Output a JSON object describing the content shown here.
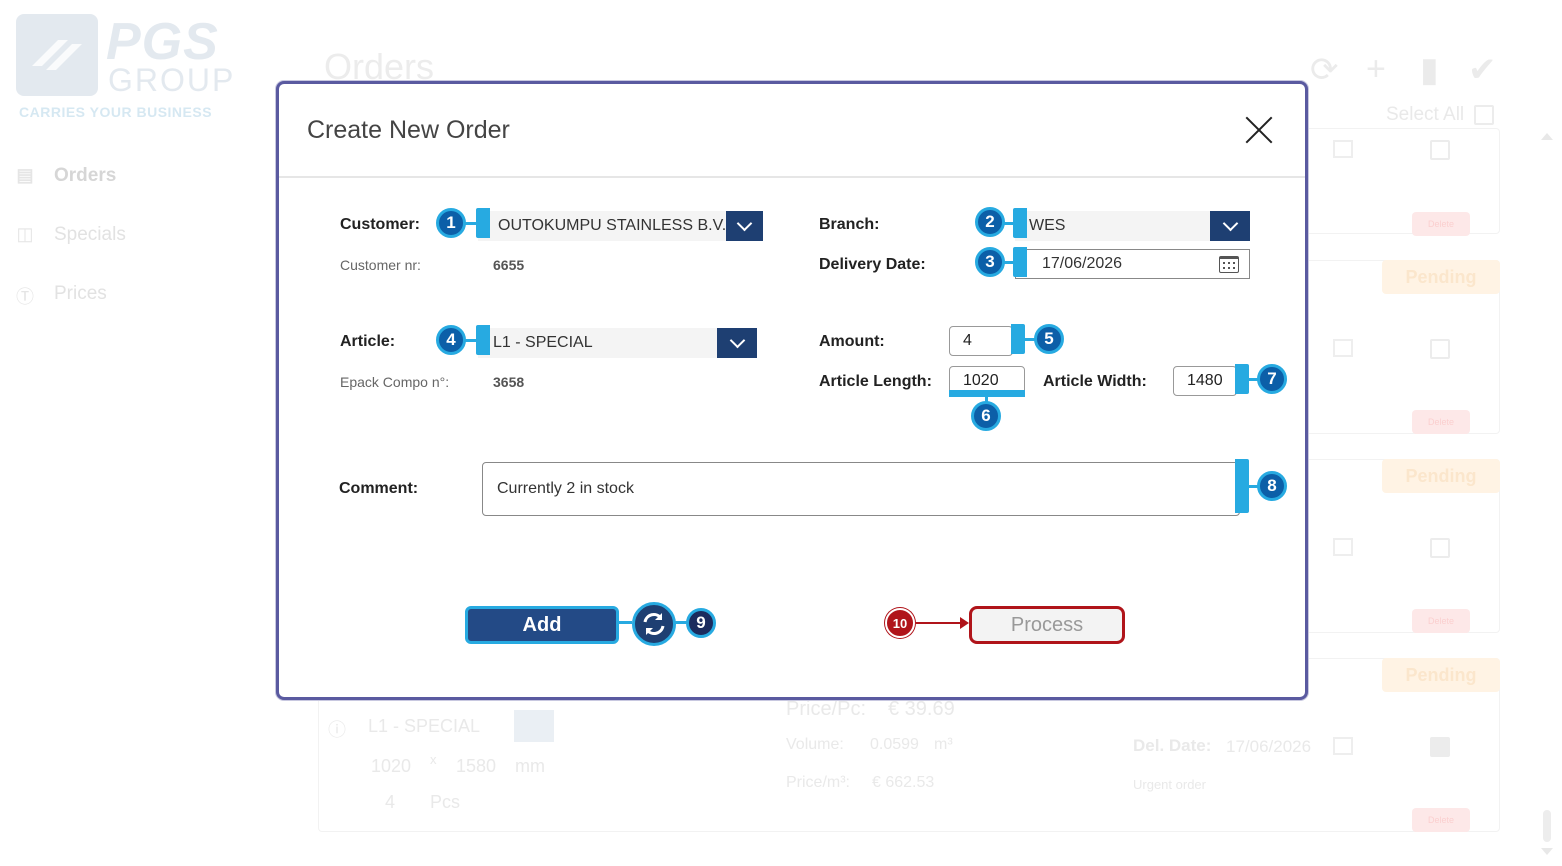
{
  "app": {
    "logo_title": "PGS",
    "logo_subtitle": "GROUP",
    "logo_tagline": "CARRIES YOUR BUSINESS",
    "nav": [
      {
        "label": "Orders",
        "icon": "document-icon"
      },
      {
        "label": "Specials",
        "icon": "layout-icon"
      },
      {
        "label": "Prices",
        "icon": "dollar-icon"
      }
    ],
    "page_title": "Orders",
    "select_all_label": "Select All",
    "pending_label": "Pending",
    "delete_label": "Delete",
    "bg_order": {
      "article": "L1 - SPECIAL",
      "length": "1020",
      "times": "x",
      "width": "1580",
      "unit": "mm",
      "amount": "4",
      "amount_unit": "Pcs",
      "price_pc_label": "Price/Pc:",
      "price_pc": "€ 39.69",
      "volume_label": "Volume:",
      "volume": "0.0599",
      "volume_unit": "m³",
      "price_m3_label": "Price/m³:",
      "price_m3": "€ 662.53",
      "del_date_label": "Del. Date:",
      "del_date": "17/06/2026",
      "note": "Urgent order"
    }
  },
  "modal": {
    "title": "Create New Order",
    "customer_label": "Customer:",
    "customer_value": "OUTOKUMPU STAINLESS B.V.",
    "customer_nr_label": "Customer nr:",
    "customer_nr_value": "6655",
    "branch_label": "Branch:",
    "branch_value": "WES",
    "delivery_date_label": "Delivery Date:",
    "delivery_date_value": "17/06/2026",
    "article_label": "Article:",
    "article_value": "L1 - SPECIAL",
    "epack_label": "Epack Compo n°:",
    "epack_value": "3658",
    "amount_label": "Amount:",
    "amount_value": "4",
    "article_length_label": "Article Length:",
    "article_length_value": "1020",
    "article_width_label": "Article Width:",
    "article_width_value": "1480",
    "comment_label": "Comment:",
    "comment_value": "Currently 2 in stock",
    "add_label": "Add",
    "process_label": "Process"
  },
  "callouts": [
    "1",
    "2",
    "3",
    "4",
    "5",
    "6",
    "7",
    "8",
    "9",
    "10"
  ],
  "colors": {
    "primary": "#1e3f72",
    "callout": "#0c5fa8",
    "callout_ring": "#27aae1",
    "danger": "#b0141a",
    "modal_border": "#5a5aa0"
  }
}
